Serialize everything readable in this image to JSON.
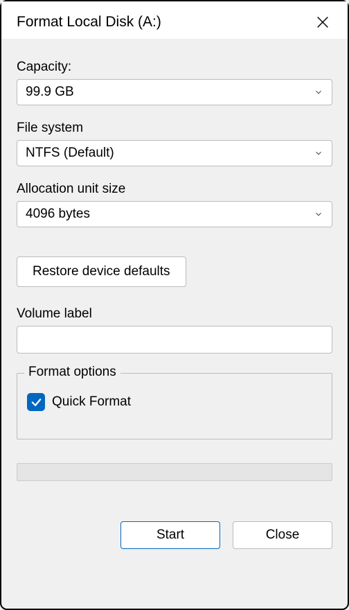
{
  "titlebar": {
    "title": "Format Local Disk (A:)"
  },
  "capacity": {
    "label": "Capacity:",
    "value": "99.9 GB"
  },
  "filesystem": {
    "label": "File system",
    "value": "NTFS (Default)"
  },
  "allocation": {
    "label": "Allocation unit size",
    "value": "4096 bytes"
  },
  "restore": {
    "label": "Restore device defaults"
  },
  "volume": {
    "label": "Volume label",
    "value": ""
  },
  "format_options": {
    "legend": "Format options",
    "quick_format_label": "Quick Format",
    "quick_format_checked": true
  },
  "buttons": {
    "start": "Start",
    "close": "Close"
  }
}
